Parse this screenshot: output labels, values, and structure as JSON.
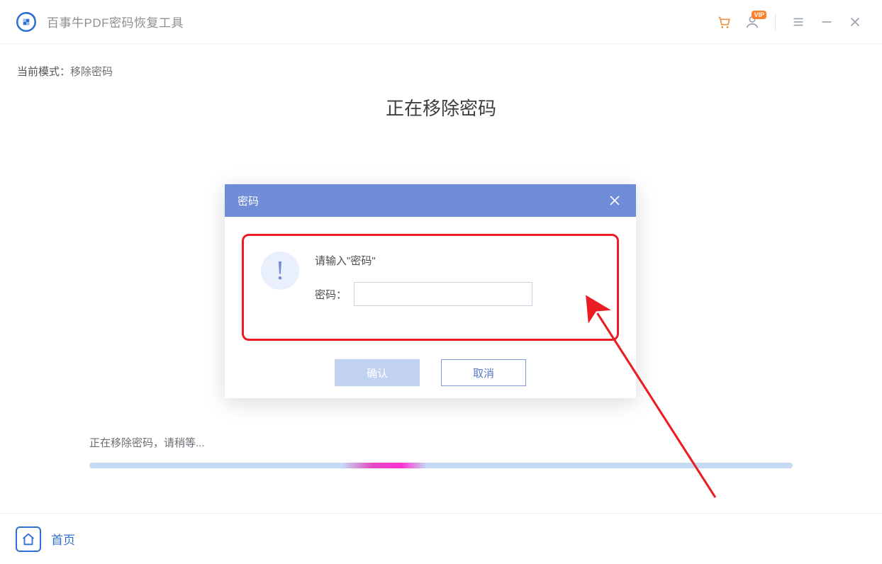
{
  "titlebar": {
    "app_title": "百事牛PDF密码恢复工具",
    "vip_badge": "VIP"
  },
  "content": {
    "mode_label": "当前模式：",
    "mode_value": "移除密码",
    "heading": "正在移除密码"
  },
  "dialog": {
    "title": "密码",
    "prompt": "请输入\"密码\"",
    "field_label": "密码：",
    "input_value": "",
    "confirm": "确认",
    "cancel": "取消"
  },
  "progress": {
    "text": "正在移除密码，请稍等..."
  },
  "footer": {
    "home": "首页"
  }
}
